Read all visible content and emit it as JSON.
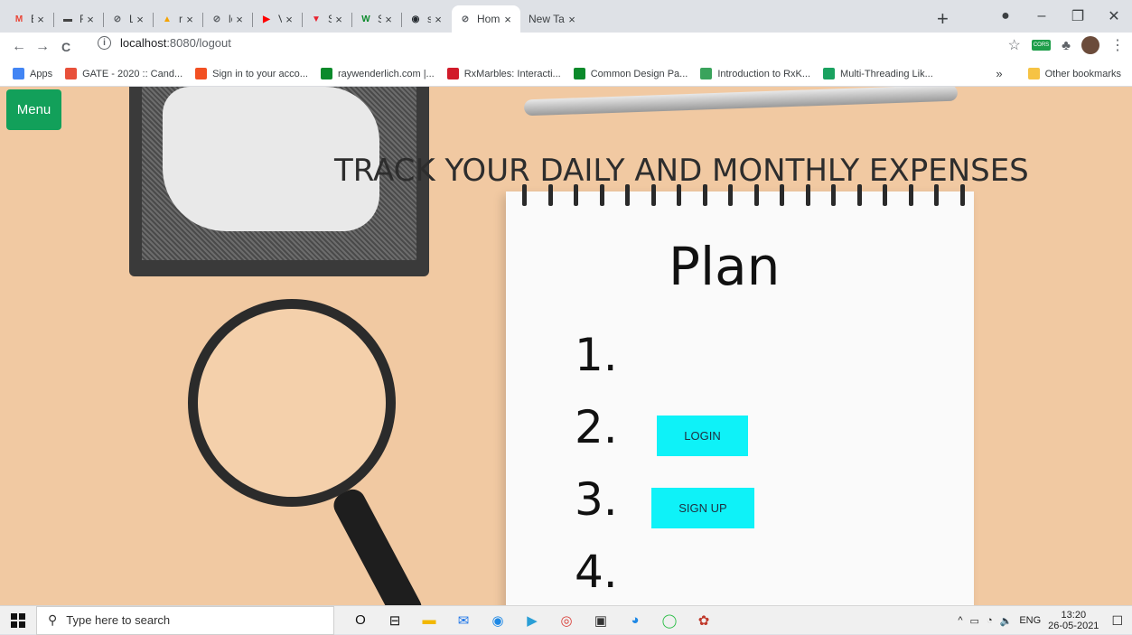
{
  "browser": {
    "tabs": [
      {
        "title": "Expens",
        "icon": "gmail-icon",
        "color": "#ea4335",
        "glyph": "M",
        "active": false
      },
      {
        "title": "Routes",
        "icon": "routes-icon",
        "color": "#444444",
        "glyph": "▬",
        "active": false
      },
      {
        "title": "Login |",
        "icon": "globe-icon",
        "color": "#5f6368",
        "glyph": "⊘",
        "active": false
      },
      {
        "title": "remote",
        "icon": "remote-icon",
        "color": "#f4a300",
        "glyph": "▲",
        "active": false
      },
      {
        "title": "localho",
        "icon": "globe-icon",
        "color": "#5f6368",
        "glyph": "⊘",
        "active": false
      },
      {
        "title": "VMwar",
        "icon": "youtube-icon",
        "color": "#ff0000",
        "glyph": "▶",
        "active": false
      },
      {
        "title": "SQL In",
        "icon": "sql-icon",
        "color": "#e8232f",
        "glyph": "▼",
        "active": false
      },
      {
        "title": "SQL IN",
        "icon": "w3-icon",
        "color": "#0b8a2b",
        "glyph": "W",
        "active": false
      },
      {
        "title": "shekha",
        "icon": "github-icon",
        "color": "#24292e",
        "glyph": "◉",
        "active": false
      },
      {
        "title": "Home",
        "icon": "globe-icon",
        "color": "#5f6368",
        "glyph": "⊘",
        "active": true
      },
      {
        "title": "New Tab",
        "icon": "",
        "color": "",
        "glyph": "",
        "active": false
      }
    ],
    "close_glyph": "×",
    "new_tab_glyph": "+",
    "window": {
      "profile": "●",
      "minimize": "–",
      "restore": "❐",
      "close": "✕"
    },
    "nav": {
      "back": "←",
      "forward": "→",
      "reload": "C"
    },
    "address": {
      "host": "localhost",
      "path": ":8080/logout",
      "info": "i"
    },
    "toolbar_right": {
      "star": "☆",
      "ext_badge": "CORS",
      "puzzle": "♣",
      "menu": "⋮"
    },
    "bookmarks": [
      {
        "label": "Apps",
        "color": "#4285f4"
      },
      {
        "label": "GATE - 2020 :: Cand...",
        "color": "#e8503a"
      },
      {
        "label": "Sign in to your acco...",
        "color": "#f25022"
      },
      {
        "label": "raywenderlich.com |...",
        "color": "#0b8a2b"
      },
      {
        "label": "RxMarbles: Interacti...",
        "color": "#d11b2a"
      },
      {
        "label": "Common Design Pa...",
        "color": "#0b8a2b"
      },
      {
        "label": "Introduction to RxK...",
        "color": "#3aa35c"
      },
      {
        "label": "Multi-Threading Lik...",
        "color": "#1aa260"
      }
    ],
    "bookmarks_more": "»",
    "other_bookmarks": "Other bookmarks"
  },
  "page": {
    "menu_label": "Menu",
    "headline": "TRACK YOUR DAILY AND MONTHLY EXPENSES",
    "image_text": {
      "plan": "Plan",
      "n1": "1.",
      "n2": "2.",
      "n3": "3.",
      "n4": "4."
    },
    "login_label": "LOGIN",
    "signup_label": "SIGN UP",
    "colors": {
      "menu": "#12a05a",
      "cta": "#0ef2f8"
    }
  },
  "taskbar": {
    "search_placeholder": "Type here to search",
    "apps": [
      "O",
      "⊟",
      "▬",
      "✉",
      "◉",
      "▶",
      "◎",
      "▣",
      "◕",
      "◯",
      "✿"
    ],
    "tray": {
      "chevron": "^",
      "lang": "ENG",
      "time": "13:20",
      "date": "26-05-2021",
      "notify": "☐"
    }
  }
}
